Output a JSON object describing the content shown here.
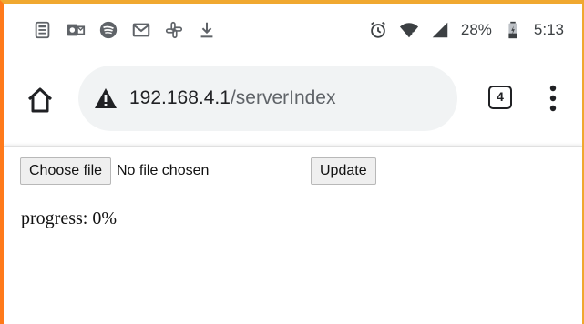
{
  "status_bar": {
    "battery_percent": "28%",
    "time": "5:13",
    "left_icons": [
      "news-icon",
      "outlook-icon",
      "spotify-icon",
      "gmail-icon",
      "slack-icon",
      "download-icon"
    ],
    "right_icons": [
      "alarm-icon",
      "wifi-icon",
      "signal-icon",
      "battery-icon"
    ]
  },
  "browser": {
    "url_host": "192.168.4.1",
    "url_path": "/serverIndex",
    "tab_count": "4",
    "security_icon": "warning-icon"
  },
  "page": {
    "choose_file_label": "Choose file",
    "file_status": "No file chosen",
    "update_label": "Update",
    "progress_text": "progress: 0%"
  },
  "colors": {
    "frame_orange": "#ff7a1a",
    "frame_top": "#f0a830",
    "omnibox_bg": "#f1f3f4"
  }
}
